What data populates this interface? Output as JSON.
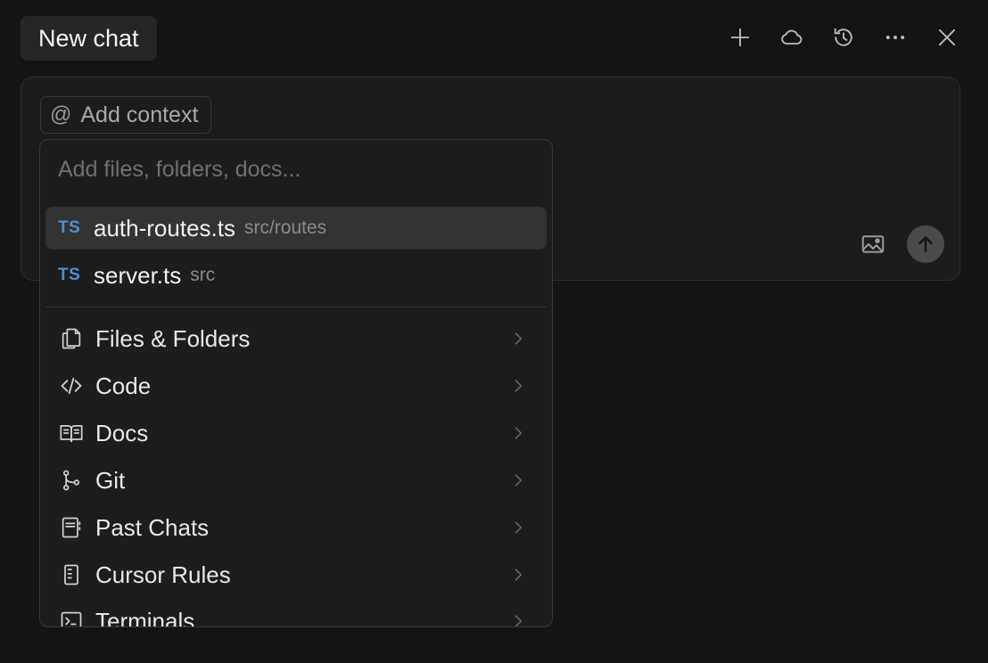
{
  "header": {
    "title": "New chat",
    "actions": [
      {
        "name": "new-chat-plus",
        "icon": "plus-icon"
      },
      {
        "name": "cloud",
        "icon": "cloud-icon"
      },
      {
        "name": "history",
        "icon": "history-icon"
      },
      {
        "name": "more",
        "icon": "ellipsis-icon"
      },
      {
        "name": "close",
        "icon": "close-icon"
      }
    ]
  },
  "composer": {
    "context_chip": {
      "symbol": "@",
      "label": "Add context"
    },
    "image_icon": "image-icon",
    "send_icon": "arrow-up-icon"
  },
  "dropdown": {
    "search_placeholder": "Add files, folders, docs...",
    "files": [
      {
        "badge": "TS",
        "name": "auth-routes.ts",
        "path": "src/routes",
        "active": true
      },
      {
        "badge": "TS",
        "name": "server.ts",
        "path": "src",
        "active": false
      }
    ],
    "categories": [
      {
        "label": "Files & Folders",
        "icon": "files-icon"
      },
      {
        "label": "Code",
        "icon": "code-icon"
      },
      {
        "label": "Docs",
        "icon": "book-icon"
      },
      {
        "label": "Git",
        "icon": "git-branch-icon"
      },
      {
        "label": "Past Chats",
        "icon": "notebook-icon"
      },
      {
        "label": "Cursor Rules",
        "icon": "ruler-icon"
      },
      {
        "label": "Terminals",
        "icon": "terminal-icon"
      }
    ]
  },
  "colors": {
    "background": "#141414",
    "ts_badge": "#4d8fd6",
    "active_row": "#333333"
  }
}
